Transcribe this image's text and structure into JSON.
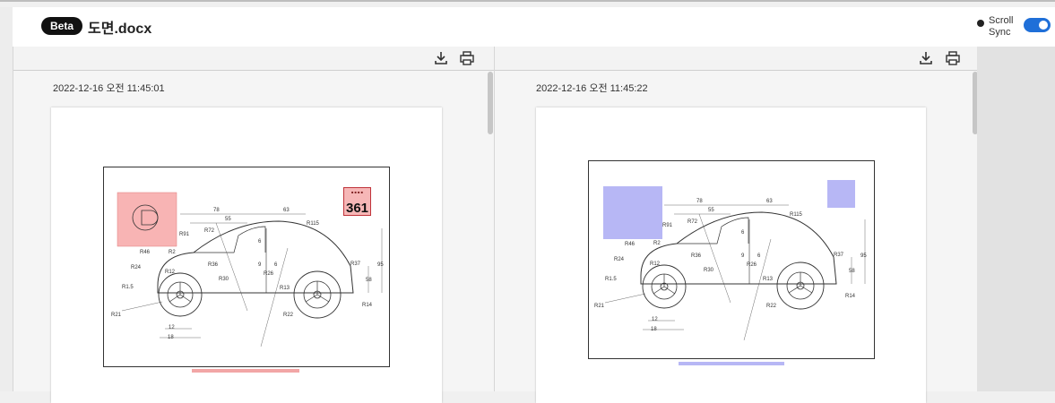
{
  "header": {
    "badge": "Beta",
    "title": "도면.docx",
    "scroll_sync_label": "Scroll Sync",
    "scroll_sync_on": true
  },
  "left_pane": {
    "timestamp": "2022-12-16 오전 11:45:01",
    "toolbar": {
      "download_icon": "download-icon",
      "print_icon": "print-icon"
    },
    "stamp_number": "361",
    "highlight_color": "#f8b4b4"
  },
  "right_pane": {
    "timestamp": "2022-12-16 오전 11:45:22",
    "toolbar": {
      "download_icon": "download-icon",
      "print_icon": "print-icon"
    },
    "highlight_color": "#b7b7f5"
  },
  "drawing_labels": {
    "dims": [
      "78",
      "55",
      "63",
      "R115",
      "R91",
      "R72",
      "R46",
      "R2",
      "R24",
      "R12",
      "R36",
      "R30",
      "R26",
      "R37",
      "R13",
      "R14",
      "R22",
      "R21",
      "R1.5",
      "9",
      "6",
      "12",
      "18",
      "95",
      "58"
    ]
  },
  "colors": {
    "accent": "#1f6fd8",
    "badge_bg": "#111111"
  }
}
